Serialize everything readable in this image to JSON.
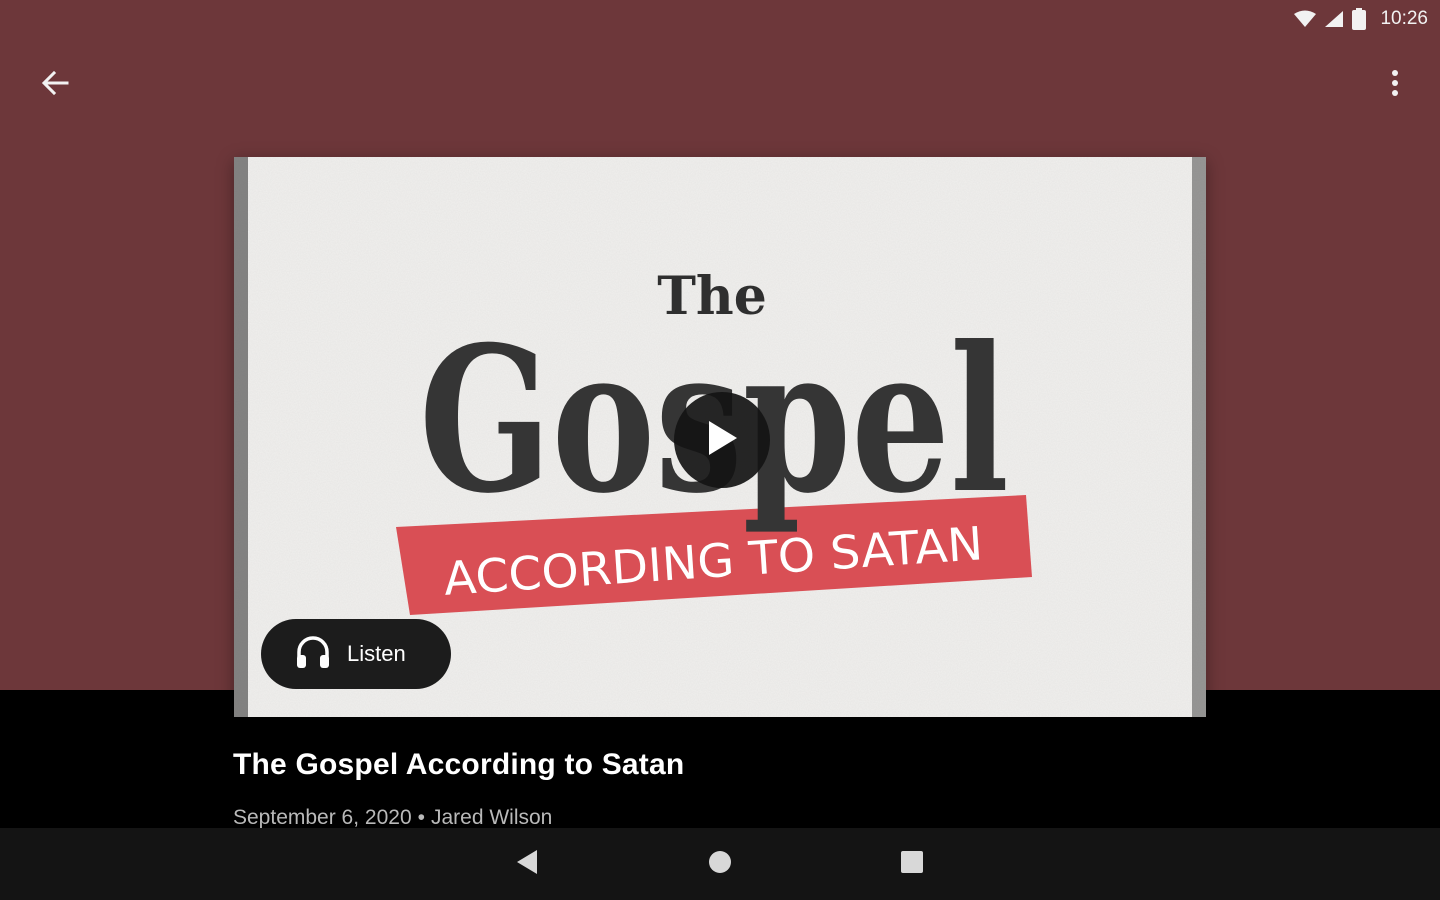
{
  "status_bar": {
    "time": "10:26",
    "icons": [
      "wifi-icon",
      "signal-icon",
      "battery-icon"
    ]
  },
  "app_bar": {
    "back_icon": "arrow-left-icon",
    "menu_icon": "more-vert-icon"
  },
  "artwork": {
    "line1": "The",
    "line2": "Gospel",
    "banner": "ACCORDING TO SATAN"
  },
  "player": {
    "play_icon": "play-icon",
    "listen_label": "Listen",
    "listen_icon": "headphones-icon"
  },
  "episode": {
    "title": "The Gospel According to Satan",
    "date": "September 6, 2020",
    "separator": "•",
    "author": "Jared Wilson"
  },
  "colors": {
    "hero_bg": "#6d373a",
    "banner_red": "#d94f55",
    "card_bg": "#f1f0ee"
  },
  "nav_bar": {
    "icons": [
      "nav-back-icon",
      "nav-home-icon",
      "nav-recents-icon"
    ]
  }
}
